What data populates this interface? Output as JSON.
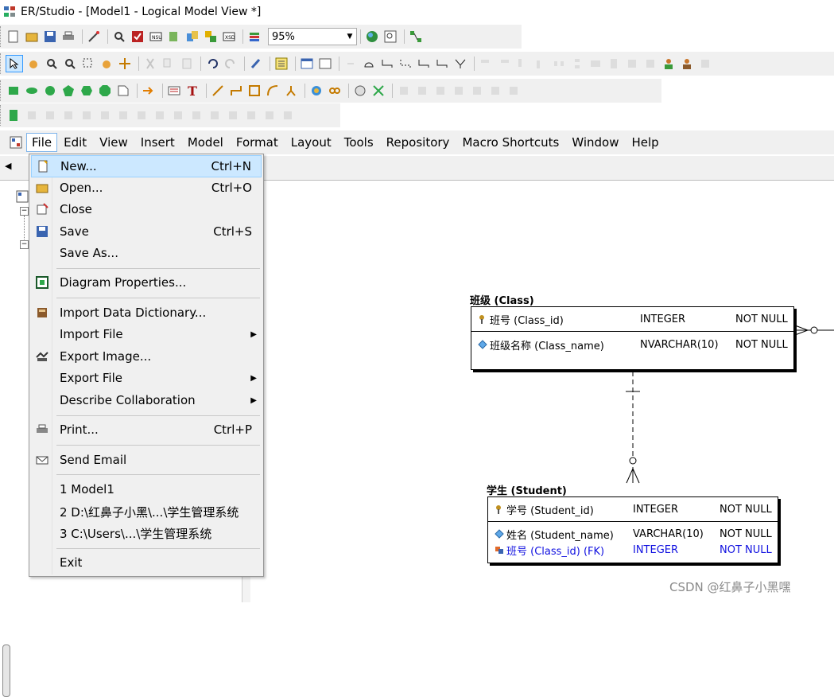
{
  "window": {
    "title": "ER/Studio - [Model1 - Logical Model View *]"
  },
  "toolbar": {
    "zoom_value": "95%"
  },
  "menubar": {
    "items": [
      {
        "label": "File"
      },
      {
        "label": "Edit"
      },
      {
        "label": "View"
      },
      {
        "label": "Insert"
      },
      {
        "label": "Model"
      },
      {
        "label": "Format"
      },
      {
        "label": "Layout"
      },
      {
        "label": "Tools"
      },
      {
        "label": "Repository"
      },
      {
        "label": "Macro Shortcuts"
      },
      {
        "label": "Window"
      },
      {
        "label": "Help"
      }
    ]
  },
  "file_menu": {
    "items": [
      {
        "label": "New...",
        "shortcut": "Ctrl+N",
        "icon": "new-document-icon"
      },
      {
        "label": "Open...",
        "shortcut": "Ctrl+O",
        "icon": "open-folder-icon"
      },
      {
        "label": "Close",
        "shortcut": "",
        "icon": "close-document-icon"
      },
      {
        "label": "Save",
        "shortcut": "Ctrl+S",
        "icon": "save-disk-icon"
      },
      {
        "label": "Save As...",
        "shortcut": "",
        "icon": ""
      },
      {
        "label": "Diagram Properties...",
        "shortcut": "",
        "icon": "diagram-properties-icon"
      },
      {
        "label": "Import Data Dictionary...",
        "shortcut": "",
        "icon": "import-dictionary-icon"
      },
      {
        "label": "Import File",
        "shortcut": "",
        "icon": ""
      },
      {
        "label": "Export Image...",
        "shortcut": "",
        "icon": "export-image-icon"
      },
      {
        "label": "Export File",
        "shortcut": "",
        "icon": ""
      },
      {
        "label": "Describe Collaboration",
        "shortcut": "",
        "icon": ""
      },
      {
        "label": "Print...",
        "shortcut": "Ctrl+P",
        "icon": "printer-icon"
      },
      {
        "label": "Send Email",
        "shortcut": "",
        "icon": "envelope-icon"
      },
      {
        "label": "1 Model1",
        "shortcut": "",
        "icon": ""
      },
      {
        "label": "2 D:\\红鼻子小黑\\...\\学生管理系统",
        "shortcut": "",
        "icon": ""
      },
      {
        "label": "3 C:\\Users\\...\\学生管理系统",
        "shortcut": "",
        "icon": ""
      },
      {
        "label": "Exit",
        "shortcut": "",
        "icon": ""
      }
    ]
  },
  "entities": {
    "class": {
      "title_cn": "班级",
      "title_en": "(Class)",
      "pk": [
        {
          "name": "班号 (Class_id)",
          "type": "INTEGER",
          "null": "NOT NULL"
        }
      ],
      "attrs": [
        {
          "name": "班级名称 (Class_name)",
          "type": "NVARCHAR(10)",
          "null": "NOT NULL"
        }
      ]
    },
    "student": {
      "title_cn": "学生",
      "title_en": "(Student)",
      "pk": [
        {
          "name": "学号 (Student_id)",
          "type": "INTEGER",
          "null": "NOT NULL"
        }
      ],
      "attrs": [
        {
          "name": "姓名 (Student_name)",
          "type": "VARCHAR(10)",
          "null": "NOT NULL"
        },
        {
          "name": "班号 (Class_id) (FK)",
          "type": "INTEGER",
          "null": "NOT NULL"
        }
      ]
    }
  },
  "watermark": "CSDN @红鼻子小黑嘿",
  "colors": {
    "menu_highlight": "#cce8ff",
    "fk_text": "#1010e0",
    "menubar_bg": "#f0f0f0"
  }
}
